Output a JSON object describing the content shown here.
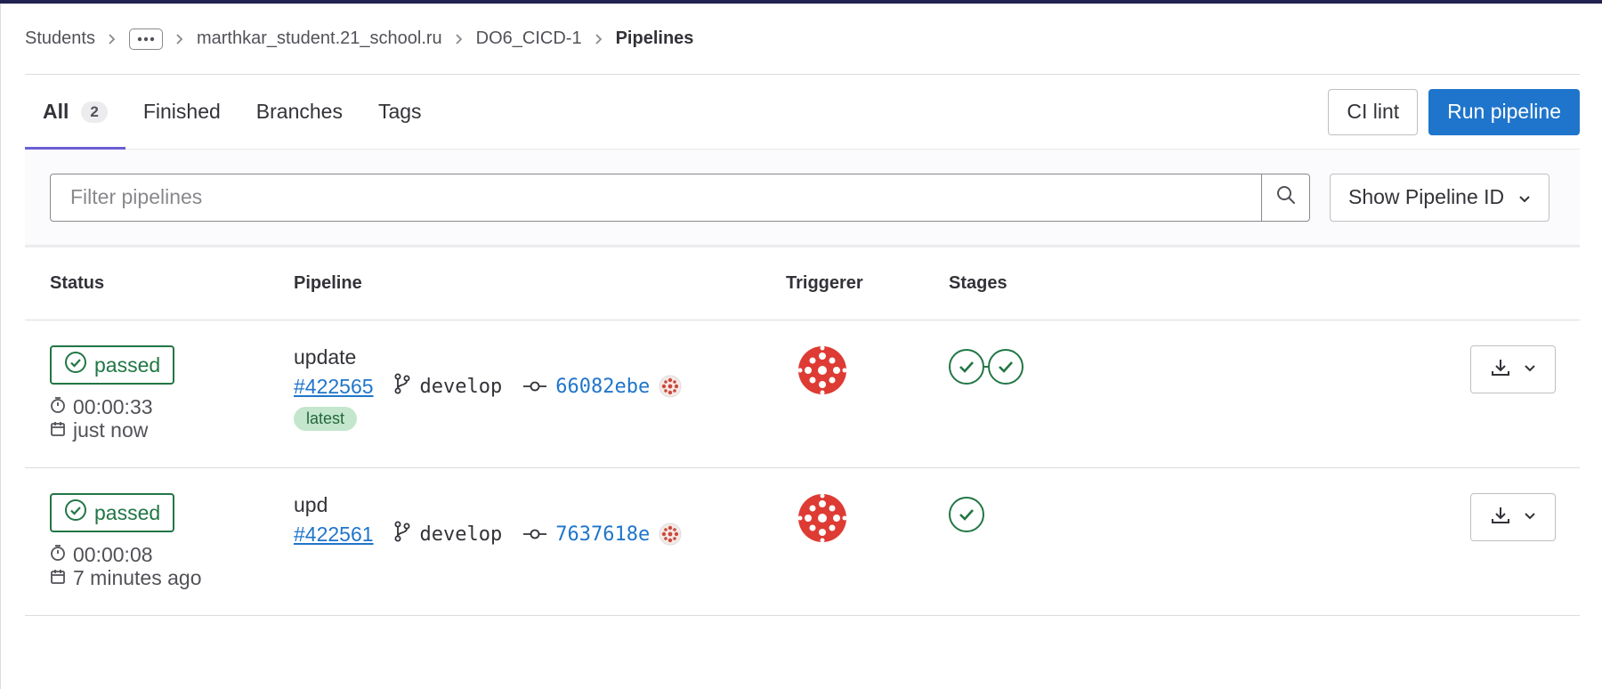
{
  "breadcrumb": {
    "items": [
      "Students",
      "marthkar_student.21_school.ru",
      "DO6_CICD-1"
    ],
    "current": "Pipelines"
  },
  "tabs": [
    {
      "label": "All",
      "count": "2"
    },
    {
      "label": "Finished"
    },
    {
      "label": "Branches"
    },
    {
      "label": "Tags"
    }
  ],
  "actions": {
    "ci_lint": "CI lint",
    "run_pipeline": "Run pipeline"
  },
  "filter": {
    "placeholder": "Filter pipelines",
    "id_dropdown": "Show Pipeline ID"
  },
  "table": {
    "headers": {
      "status": "Status",
      "pipeline": "Pipeline",
      "triggerer": "Triggerer",
      "stages": "Stages"
    },
    "rows": [
      {
        "status": "passed",
        "duration": "00:00:33",
        "finished": "just now",
        "title": "update",
        "id": "#422565",
        "ref": "develop",
        "sha": "66082ebe",
        "badge": "latest",
        "stages": 2
      },
      {
        "status": "passed",
        "duration": "00:00:08",
        "finished": "7 minutes ago",
        "title": "upd",
        "id": "#422561",
        "ref": "develop",
        "sha": "7637618e",
        "stages": 1
      }
    ]
  },
  "colors": {
    "accent": "#1f75cb",
    "success": "#217645",
    "avatar": "#dd2b0e"
  }
}
